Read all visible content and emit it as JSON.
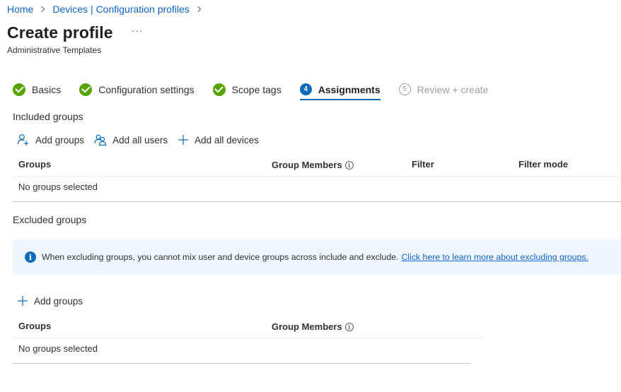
{
  "breadcrumb": {
    "items": [
      {
        "label": "Home"
      },
      {
        "label": "Devices | Configuration profiles"
      }
    ]
  },
  "header": {
    "title": "Create profile",
    "more_label": "···",
    "subtitle": "Administrative Templates"
  },
  "steps": [
    {
      "label": "Basics",
      "status": "complete"
    },
    {
      "label": "Configuration settings",
      "status": "complete"
    },
    {
      "label": "Scope tags",
      "status": "complete"
    },
    {
      "number": "4",
      "label": "Assignments",
      "status": "active"
    },
    {
      "number": "5",
      "label": "Review + create",
      "status": "disabled"
    }
  ],
  "included": {
    "heading": "Included groups",
    "commands": {
      "add_groups": "Add groups",
      "add_all_users": "Add all users",
      "add_all_devices": "Add all devices"
    },
    "columns": {
      "groups": "Groups",
      "group_members": "Group Members",
      "filter": "Filter",
      "filter_mode": "Filter mode"
    },
    "empty_text": "No groups selected"
  },
  "excluded": {
    "heading": "Excluded groups",
    "info_text": "When excluding groups, you cannot mix user and device groups across include and exclude.",
    "info_link": "Click here to learn more about excluding groups.",
    "commands": {
      "add_groups": "Add groups"
    },
    "columns": {
      "groups": "Groups",
      "group_members": "Group Members"
    },
    "empty_text": "No groups selected"
  },
  "colors": {
    "link": "#0f62c6",
    "accent": "#0f6cbd",
    "success": "#57a300",
    "info_bg": "#f0f6fe"
  },
  "icons": {
    "step_complete": "checkmark-circle-icon",
    "info": "info-icon",
    "add_groups": "add-person-icon",
    "add_all_users": "people-icon",
    "add": "plus-icon"
  }
}
